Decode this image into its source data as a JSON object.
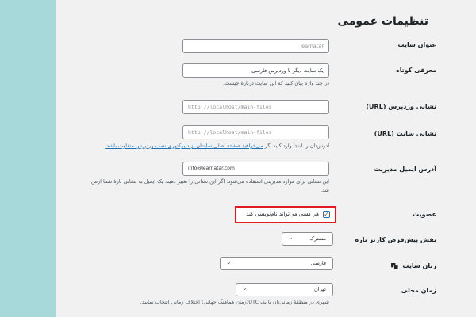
{
  "page_title": "تنظیمات عمومی",
  "site_title": {
    "label": "عنوان سایت",
    "value": "learnatar"
  },
  "tagline": {
    "label": "معرفی کوتاه",
    "value": "یک سایت دیگر با وردپرس فارسی",
    "description": "در چند واژه بیان کنید که این سایت دربارهٔ چیست."
  },
  "wp_address": {
    "label": "نشانی وردپرس (URL)",
    "value": "http://localhost/main-files"
  },
  "site_address": {
    "label": "نشانی سایت (URL)",
    "value": "http://localhost/main-files",
    "description_before": "آدرس‌تان را اینجا وارد کنید اگر ",
    "description_link": "می‌خواهید صفحه اصلی سایتتان از دایرکتوری نصب وردپرس متفاوت باشد."
  },
  "admin_email": {
    "label": "آدرس ایمیل مدیریت",
    "value": "info@learnatar.com",
    "description_line1": "این نشانی برای موارد مدیریتی استفاده می‌شود. اگر این نشانی را تغییر دهید، یک ایمیل به نشانی تازهٔ شما ارس",
    "description_line2": "شد."
  },
  "membership": {
    "label": "عضویت",
    "checkbox_label": "هر کسی می‌تواند نام‌نویسی کند",
    "checked": true
  },
  "default_role": {
    "label": "نقش پیش‌فرض کاربر تازه",
    "value": "مشترک"
  },
  "site_language": {
    "label": "زبان سایت",
    "value": "فارسی"
  },
  "timezone": {
    "label": "زمان محلی",
    "value": "تهران",
    "description": "شهری در منطقهٔ زمانی‌تان یا یک UTC(زمان هماهنگ جهانی) اختلاف زمانی انتخاب نمایید."
  },
  "colors": {
    "accent": "#2271b1",
    "highlight": "#e01b24"
  }
}
